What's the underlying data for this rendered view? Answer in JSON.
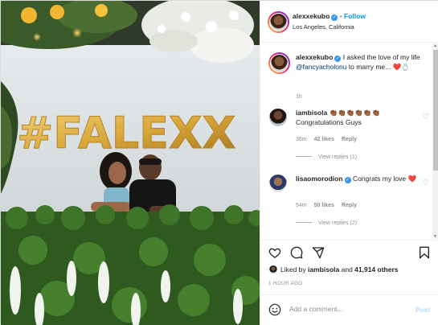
{
  "post": {
    "username": "alexxekubo",
    "follow_label": "Follow",
    "location": "Los Angeles, California",
    "balloon_text": "#FALEXX"
  },
  "caption": {
    "username": "alexxekubo",
    "text_before": "I asked the love of my life ",
    "mention": "@fancyacholonu",
    "text_after": " to marry me...",
    "emoji": "❤️💍",
    "time": "1h"
  },
  "comments": [
    {
      "username": "iambisola",
      "emoji": "👏🏾👏🏾👏🏾👏🏾👏🏾👏🏾",
      "text": "Congratulations Guys",
      "time": "36m",
      "likes": "42 likes",
      "reply": "Reply",
      "view_replies": "View replies (1)"
    },
    {
      "username": "lisaomorodion",
      "text": "Congrats my love",
      "emoji": "❤️",
      "time": "54m",
      "likes": "50 likes",
      "reply": "Reply",
      "view_replies": "View replies (2)"
    }
  ],
  "actions": {
    "like_icon": "heart-icon",
    "comment_icon": "comment-icon",
    "share_icon": "share-icon",
    "save_icon": "bookmark-icon"
  },
  "likes": {
    "prefix": "Liked by ",
    "user": "iambisola",
    "middle": " and ",
    "count": "41,914 others"
  },
  "time_ago": "1 HOUR AGO",
  "add_comment": {
    "placeholder": "Add a comment...",
    "post_label": "Post",
    "emoji_icon": "smiley-icon"
  },
  "colors": {
    "link_blue": "#0095f6",
    "verified_blue": "#3897f0",
    "heart_red": "#ed4956",
    "balloon_gold": "#d9a93a"
  }
}
